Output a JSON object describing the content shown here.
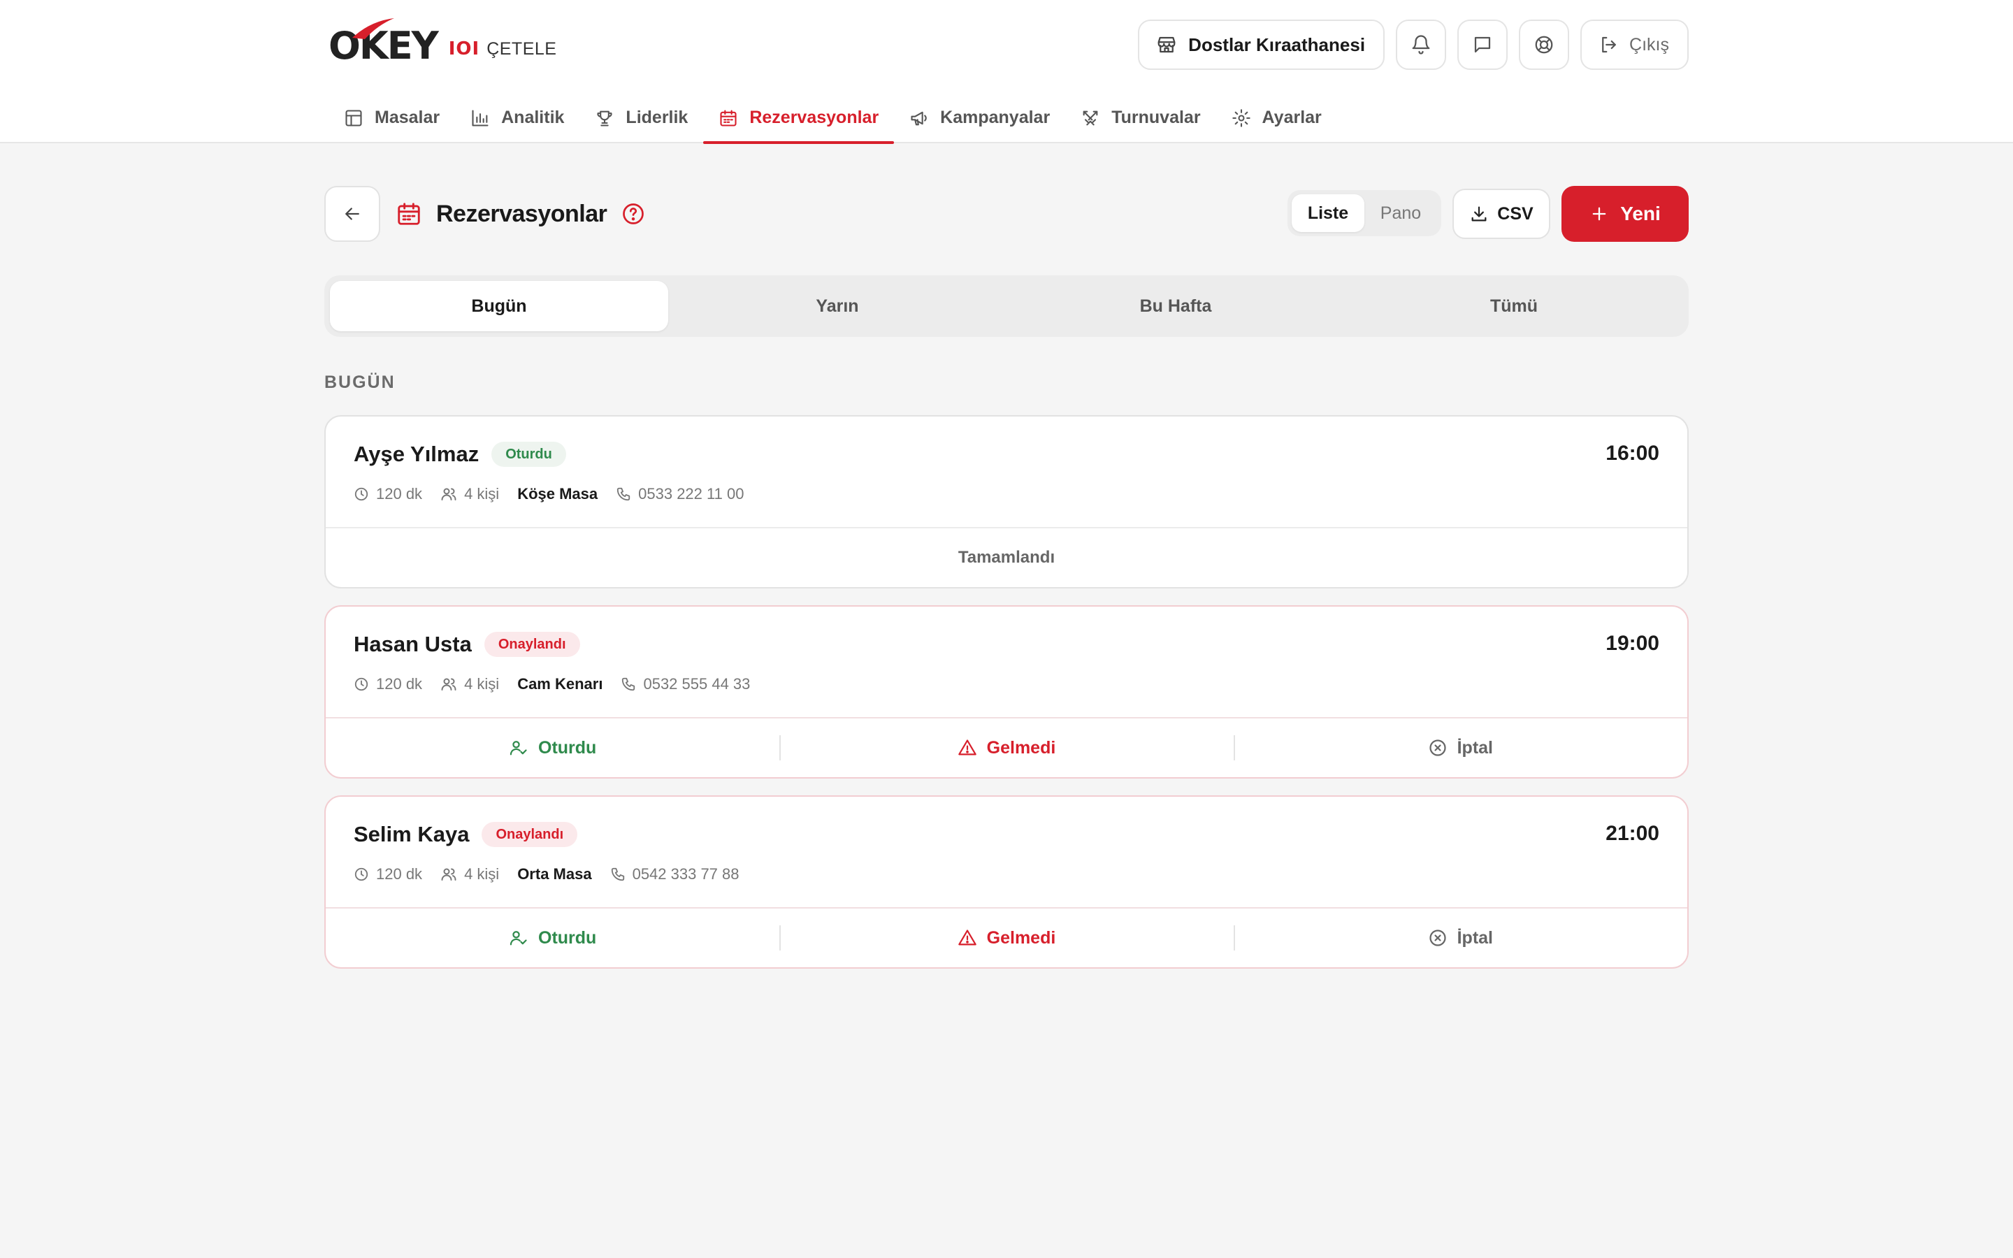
{
  "brand": {
    "logo_text": "OKEY",
    "logo_tiles": "IOI",
    "logo_sub": "ÇETELE",
    "accent_color": "#d71f2b"
  },
  "header": {
    "shop_name": "Dostlar Kıraathanesi",
    "logout_label": "Çıkış"
  },
  "nav": {
    "items": [
      {
        "label": "Masalar",
        "icon": "table-icon"
      },
      {
        "label": "Analitik",
        "icon": "bar-chart-icon"
      },
      {
        "label": "Liderlik",
        "icon": "trophy-icon"
      },
      {
        "label": "Rezervasyonlar",
        "icon": "calendar-icon"
      },
      {
        "label": "Kampanyalar",
        "icon": "megaphone-icon"
      },
      {
        "label": "Turnuvalar",
        "icon": "swords-icon"
      },
      {
        "label": "Ayarlar",
        "icon": "gear-icon"
      }
    ],
    "active": "Rezervasyonlar"
  },
  "page": {
    "title": "Rezervasyonlar",
    "view_options": [
      "Liste",
      "Pano"
    ],
    "view_selected": "Liste",
    "csv_label": "CSV",
    "new_label": "Yeni"
  },
  "filters": {
    "tabs": [
      "Bugün",
      "Yarın",
      "Bu Hafta",
      "Tümü"
    ],
    "selected": "Bugün"
  },
  "section_label": "BUGÜN",
  "reservations": [
    {
      "name": "Ayşe Yılmaz",
      "status": "Oturdu",
      "time": "16:00",
      "duration": "120 dk",
      "people": "4 kişi",
      "table": "Köşe Masa",
      "phone": "0533 222 11 00",
      "completed_label": "Tamamlandı"
    },
    {
      "name": "Hasan Usta",
      "status": "Onaylandı",
      "time": "19:00",
      "duration": "120 dk",
      "people": "4 kişi",
      "table": "Cam Kenarı",
      "phone": "0532 555 44 33",
      "actions": {
        "seat": "Oturdu",
        "noshow": "Gelmedi",
        "cancel": "İptal"
      }
    },
    {
      "name": "Selim Kaya",
      "status": "Onaylandı",
      "time": "21:00",
      "duration": "120 dk",
      "people": "4 kişi",
      "table": "Orta Masa",
      "phone": "0542 333 77 88",
      "actions": {
        "seat": "Oturdu",
        "noshow": "Gelmedi",
        "cancel": "İptal"
      }
    }
  ]
}
